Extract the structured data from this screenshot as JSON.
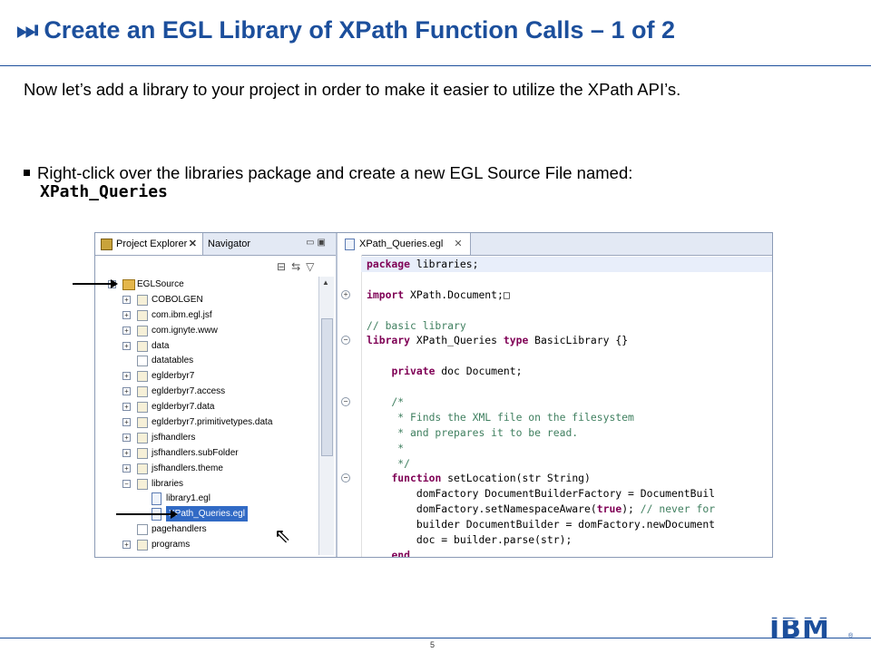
{
  "slide": {
    "title_icon": "fast-forward-icon",
    "title": "Create an EGL Library of XPath Function Calls – 1 of 2",
    "paragraph": "Now let’s add a library to your project in order to make it easier to utilize the XPath API’s.",
    "bullet_text": "Right-click over the libraries package and create a new EGL Source File named:",
    "bullet_filename": "XPath_Queries",
    "page_number": "5",
    "logo": "IBM",
    "logo_reg": "®"
  },
  "explorer": {
    "tab_label": "Project Explorer",
    "tab_close": "✕",
    "navigator_tab": "Navigator",
    "tree": [
      {
        "label": "EGLSource",
        "indent": 0,
        "toggle": "−",
        "icon": "folder"
      },
      {
        "label": "COBOLGEN",
        "indent": 1,
        "toggle": "+",
        "icon": "package"
      },
      {
        "label": "com.ibm.egl.jsf",
        "indent": 1,
        "toggle": "+",
        "icon": "package"
      },
      {
        "label": "com.ignyte.www",
        "indent": 1,
        "toggle": "+",
        "icon": "package"
      },
      {
        "label": "data",
        "indent": 1,
        "toggle": "+",
        "icon": "package"
      },
      {
        "label": "datatables",
        "indent": 1,
        "toggle": "",
        "icon": "package-empty"
      },
      {
        "label": "eglderbyr7",
        "indent": 1,
        "toggle": "+",
        "icon": "package"
      },
      {
        "label": "eglderbyr7.access",
        "indent": 1,
        "toggle": "+",
        "icon": "package"
      },
      {
        "label": "eglderbyr7.data",
        "indent": 1,
        "toggle": "+",
        "icon": "package"
      },
      {
        "label": "eglderbyr7.primitivetypes.data",
        "indent": 1,
        "toggle": "+",
        "icon": "package"
      },
      {
        "label": "jsfhandlers",
        "indent": 1,
        "toggle": "+",
        "icon": "package"
      },
      {
        "label": "jsfhandlers.subFolder",
        "indent": 1,
        "toggle": "+",
        "icon": "package"
      },
      {
        "label": "jsfhandlers.theme",
        "indent": 1,
        "toggle": "+",
        "icon": "package"
      },
      {
        "label": "libraries",
        "indent": 1,
        "toggle": "−",
        "icon": "package"
      },
      {
        "label": "library1.egl",
        "indent": 2,
        "toggle": "",
        "icon": "file"
      },
      {
        "label": "XPath_Queries.egl",
        "indent": 2,
        "toggle": "",
        "icon": "file",
        "selected": true
      },
      {
        "label": "pagehandlers",
        "indent": 1,
        "toggle": "",
        "icon": "package-empty"
      },
      {
        "label": "programs",
        "indent": 1,
        "toggle": "+",
        "icon": "package"
      }
    ]
  },
  "editor": {
    "tab_label": "XPath_Queries.egl",
    "tab_close": "✕",
    "lines": [
      {
        "text": "package libraries;",
        "style": "kw-first",
        "fold": "",
        "hl": true
      },
      {
        "text": "",
        "style": "plain",
        "fold": ""
      },
      {
        "text": "import XPath.Document;□",
        "style": "kw-first",
        "fold": "+"
      },
      {
        "text": "",
        "style": "plain",
        "fold": ""
      },
      {
        "text": "// basic library",
        "style": "comment",
        "fold": ""
      },
      {
        "text": "library XPath_Queries type BasicLibrary {}",
        "style": "library",
        "fold": "−"
      },
      {
        "text": "",
        "style": "plain",
        "fold": ""
      },
      {
        "text": "    private doc Document;",
        "style": "kw-first",
        "fold": ""
      },
      {
        "text": "",
        "style": "plain",
        "fold": ""
      },
      {
        "text": "    /*",
        "style": "comment",
        "fold": "−"
      },
      {
        "text": "     * Finds the XML file on the filesystem",
        "style": "comment",
        "fold": ""
      },
      {
        "text": "     * and prepares it to be read.",
        "style": "comment",
        "fold": ""
      },
      {
        "text": "     *",
        "style": "comment",
        "fold": ""
      },
      {
        "text": "     */",
        "style": "comment",
        "fold": ""
      },
      {
        "text": "    function setLocation(str String)",
        "style": "function",
        "fold": "−"
      },
      {
        "text": "        domFactory DocumentBuilderFactory = DocumentBuil",
        "style": "plain",
        "fold": ""
      },
      {
        "text": "        domFactory.setNamespaceAware(true); // never for",
        "style": "truecomment",
        "fold": ""
      },
      {
        "text": "        builder DocumentBuilder = domFactory.newDocument",
        "style": "plain",
        "fold": ""
      },
      {
        "text": "        doc = builder.parse(str);",
        "style": "plain",
        "fold": ""
      },
      {
        "text": "    end",
        "style": "kw-first",
        "fold": ""
      }
    ]
  },
  "colors": {
    "title_blue": "#1c4f9c",
    "keyword": "#7f0055",
    "comment": "#3f7f5f",
    "selection": "#316ac5"
  }
}
